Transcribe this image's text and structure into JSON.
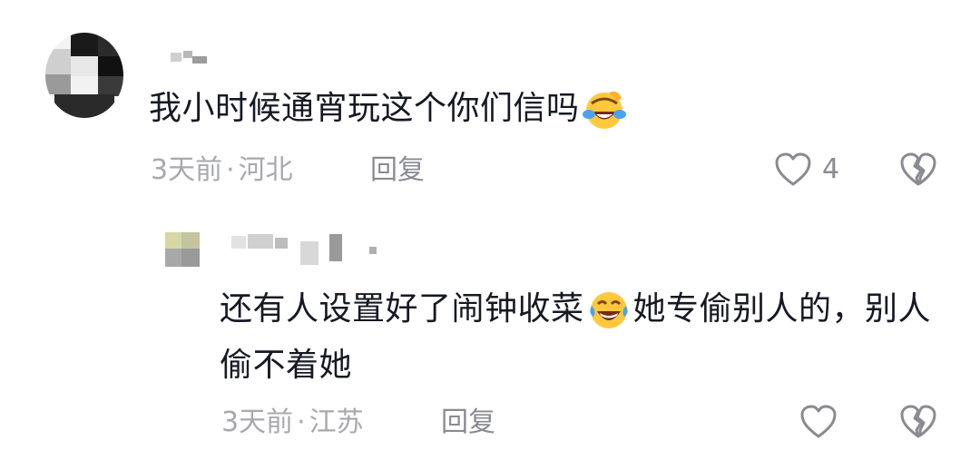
{
  "comment": {
    "text": "我小时候通宵玩这个你们信吗",
    "emoji": "crying-laughing-face",
    "time": "3天前",
    "separator": "·",
    "location": "河北",
    "reply_label": "回复",
    "like_count": "4"
  },
  "reply": {
    "text_part1": "还有人设置好了闹钟收菜",
    "emoji": "tears-of-joy-face",
    "text_part2": "她专偷别人的，别人偷不着她",
    "time": "3天前",
    "separator": "·",
    "location": "江苏",
    "reply_label": "回复"
  },
  "colors": {
    "text": "#161823",
    "meta": "#a8a9ad",
    "icon_stroke": "#8a8b91",
    "emoji_yellow": "#ffc83d",
    "emoji_tear": "#4aa3f0"
  }
}
